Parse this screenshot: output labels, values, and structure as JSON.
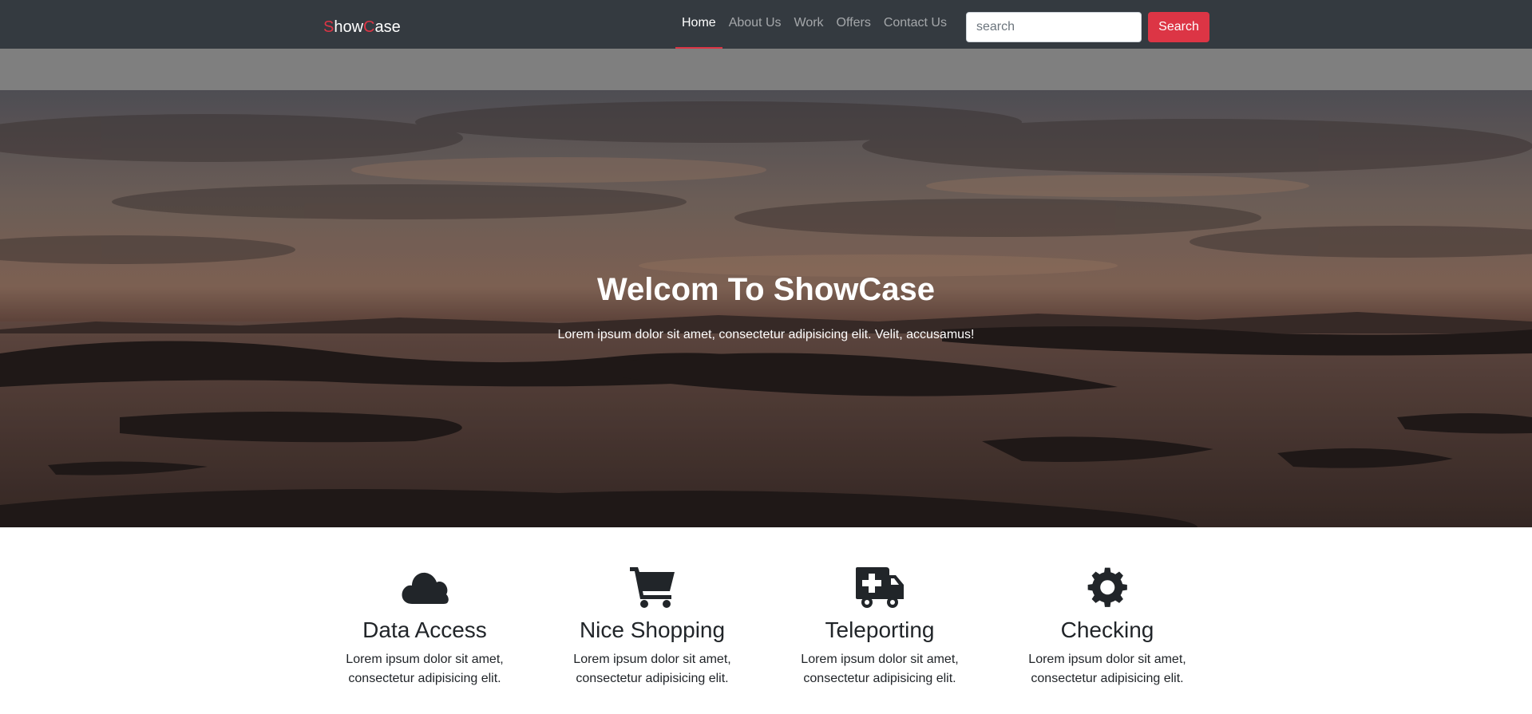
{
  "brand": {
    "s": "S",
    "how": "how",
    "c": "C",
    "ase": "ase"
  },
  "nav": {
    "items": [
      {
        "label": "Home"
      },
      {
        "label": "About Us"
      },
      {
        "label": "Work"
      },
      {
        "label": "Offers"
      },
      {
        "label": "Contact Us"
      }
    ],
    "active": "Home"
  },
  "search": {
    "placeholder": "search",
    "value": "",
    "button_label": "Search"
  },
  "hero": {
    "title": "Welcom To ShowCase",
    "subtitle": "Lorem ipsum dolor sit amet, consectetur adipisicing elit. Velit, accusamus!"
  },
  "features": [
    {
      "icon": "cloud-icon",
      "title": "Data Access",
      "text": "Lorem ipsum dolor sit amet, consectetur adipisicing elit."
    },
    {
      "icon": "shopping-cart-icon",
      "title": "Nice Shopping",
      "text": "Lorem ipsum dolor sit amet, consectetur adipisicing elit."
    },
    {
      "icon": "ambulance-icon",
      "title": "Teleporting",
      "text": "Lorem ipsum dolor sit amet, consectetur adipisicing elit."
    },
    {
      "icon": "gear-icon",
      "title": "Checking",
      "text": "Lorem ipsum dolor sit amet, consectetur adipisicing elit."
    }
  ],
  "colors": {
    "navbar": "#343a40",
    "accent": "#dc3545",
    "band": "#7f7f7f"
  }
}
